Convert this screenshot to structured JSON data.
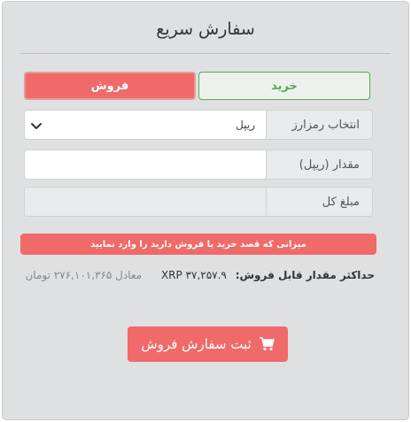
{
  "page": {
    "title": "سفارش سریع"
  },
  "tabs": {
    "buy": "خرید",
    "sell": "فروش",
    "active": "sell"
  },
  "form": {
    "crypto_label": "انتخاب رمزارز",
    "crypto_value": "ریپل",
    "amount_label": "مقدار (ریپل)",
    "amount_value": "",
    "total_label": "مبلغ کل",
    "total_value": ""
  },
  "alert": {
    "text": "میزانی که قصد خرید یا فروش دارید را وارد نمایید"
  },
  "max": {
    "label": "حداکثر مقدار قابل فروش:",
    "value": "XRP ۳۷,۲۵۷.۹",
    "equivalent": "معادل ۲۷۶,۱۰۱,۳۶۵ تومان"
  },
  "submit": {
    "label": "ثبت سفارش فروش",
    "icon": "cart-icon"
  },
  "colors": {
    "panel_bg": "#dfe0e1",
    "sell_red": "#f06a6a",
    "buy_green": "#4caf50"
  }
}
